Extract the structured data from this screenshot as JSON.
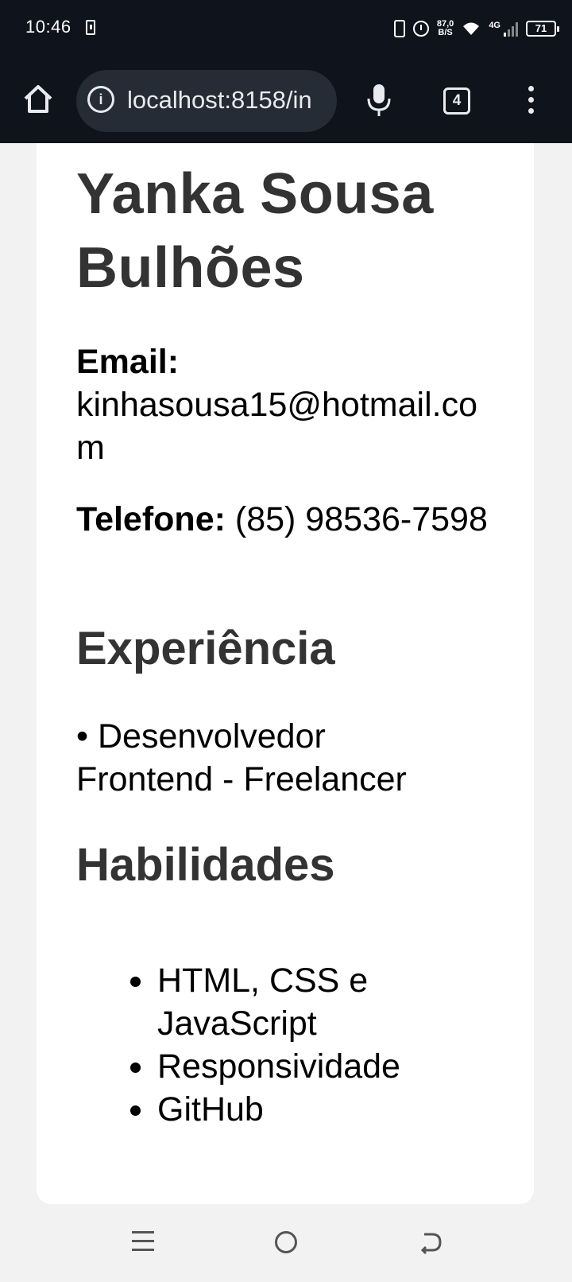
{
  "status": {
    "time": "10:46",
    "speed_value": "87,0",
    "speed_unit": "B/S",
    "network": "4G",
    "battery": "71"
  },
  "browser": {
    "url": "localhost:8158/in",
    "tab_count": "4"
  },
  "profile": {
    "name": "Yanka Sousa Bulhões",
    "email_label": "Email:",
    "email_value": "kinhasousa15@hotmail.com",
    "phone_label": "Telefone:",
    "phone_value": "(85) 98536-7598",
    "experience_title": "Experiência",
    "experience_item": "• Desenvolvedor Frontend - Freelancer",
    "skills_title": "Habilidades",
    "skills": [
      "HTML, CSS e JavaScript",
      "Responsividade",
      "GitHub"
    ]
  }
}
